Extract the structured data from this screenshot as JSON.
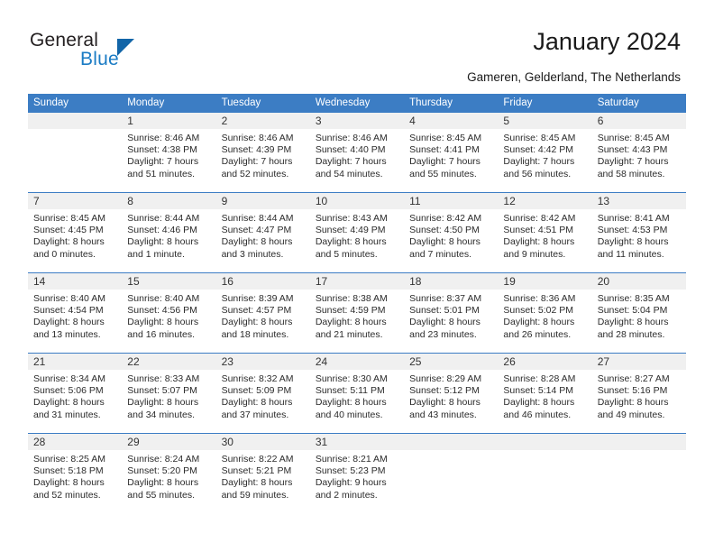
{
  "brand": {
    "name_primary": "General",
    "name_secondary": "Blue",
    "triangle_icon": "logo-triangle-icon",
    "color_primary": "#231f20",
    "color_secondary": "#1a7bc4",
    "color_triangle": "#1265a8"
  },
  "header": {
    "title": "January 2024",
    "subtitle": "Gameren, Gelderland, The Netherlands"
  },
  "theme": {
    "header_band": "#3c7dc4",
    "day_number_band": "#f0f0f0",
    "text": "#2b2b2b"
  },
  "weekdays": [
    "Sunday",
    "Monday",
    "Tuesday",
    "Wednesday",
    "Thursday",
    "Friday",
    "Saturday"
  ],
  "weeks": [
    [
      {
        "day": "",
        "sunrise": "",
        "sunset": "",
        "daylight1": "",
        "daylight2": ""
      },
      {
        "day": "1",
        "sunrise": "Sunrise: 8:46 AM",
        "sunset": "Sunset: 4:38 PM",
        "daylight1": "Daylight: 7 hours",
        "daylight2": "and 51 minutes."
      },
      {
        "day": "2",
        "sunrise": "Sunrise: 8:46 AM",
        "sunset": "Sunset: 4:39 PM",
        "daylight1": "Daylight: 7 hours",
        "daylight2": "and 52 minutes."
      },
      {
        "day": "3",
        "sunrise": "Sunrise: 8:46 AM",
        "sunset": "Sunset: 4:40 PM",
        "daylight1": "Daylight: 7 hours",
        "daylight2": "and 54 minutes."
      },
      {
        "day": "4",
        "sunrise": "Sunrise: 8:45 AM",
        "sunset": "Sunset: 4:41 PM",
        "daylight1": "Daylight: 7 hours",
        "daylight2": "and 55 minutes."
      },
      {
        "day": "5",
        "sunrise": "Sunrise: 8:45 AM",
        "sunset": "Sunset: 4:42 PM",
        "daylight1": "Daylight: 7 hours",
        "daylight2": "and 56 minutes."
      },
      {
        "day": "6",
        "sunrise": "Sunrise: 8:45 AM",
        "sunset": "Sunset: 4:43 PM",
        "daylight1": "Daylight: 7 hours",
        "daylight2": "and 58 minutes."
      }
    ],
    [
      {
        "day": "7",
        "sunrise": "Sunrise: 8:45 AM",
        "sunset": "Sunset: 4:45 PM",
        "daylight1": "Daylight: 8 hours",
        "daylight2": "and 0 minutes."
      },
      {
        "day": "8",
        "sunrise": "Sunrise: 8:44 AM",
        "sunset": "Sunset: 4:46 PM",
        "daylight1": "Daylight: 8 hours",
        "daylight2": "and 1 minute."
      },
      {
        "day": "9",
        "sunrise": "Sunrise: 8:44 AM",
        "sunset": "Sunset: 4:47 PM",
        "daylight1": "Daylight: 8 hours",
        "daylight2": "and 3 minutes."
      },
      {
        "day": "10",
        "sunrise": "Sunrise: 8:43 AM",
        "sunset": "Sunset: 4:49 PM",
        "daylight1": "Daylight: 8 hours",
        "daylight2": "and 5 minutes."
      },
      {
        "day": "11",
        "sunrise": "Sunrise: 8:42 AM",
        "sunset": "Sunset: 4:50 PM",
        "daylight1": "Daylight: 8 hours",
        "daylight2": "and 7 minutes."
      },
      {
        "day": "12",
        "sunrise": "Sunrise: 8:42 AM",
        "sunset": "Sunset: 4:51 PM",
        "daylight1": "Daylight: 8 hours",
        "daylight2": "and 9 minutes."
      },
      {
        "day": "13",
        "sunrise": "Sunrise: 8:41 AM",
        "sunset": "Sunset: 4:53 PM",
        "daylight1": "Daylight: 8 hours",
        "daylight2": "and 11 minutes."
      }
    ],
    [
      {
        "day": "14",
        "sunrise": "Sunrise: 8:40 AM",
        "sunset": "Sunset: 4:54 PM",
        "daylight1": "Daylight: 8 hours",
        "daylight2": "and 13 minutes."
      },
      {
        "day": "15",
        "sunrise": "Sunrise: 8:40 AM",
        "sunset": "Sunset: 4:56 PM",
        "daylight1": "Daylight: 8 hours",
        "daylight2": "and 16 minutes."
      },
      {
        "day": "16",
        "sunrise": "Sunrise: 8:39 AM",
        "sunset": "Sunset: 4:57 PM",
        "daylight1": "Daylight: 8 hours",
        "daylight2": "and 18 minutes."
      },
      {
        "day": "17",
        "sunrise": "Sunrise: 8:38 AM",
        "sunset": "Sunset: 4:59 PM",
        "daylight1": "Daylight: 8 hours",
        "daylight2": "and 21 minutes."
      },
      {
        "day": "18",
        "sunrise": "Sunrise: 8:37 AM",
        "sunset": "Sunset: 5:01 PM",
        "daylight1": "Daylight: 8 hours",
        "daylight2": "and 23 minutes."
      },
      {
        "day": "19",
        "sunrise": "Sunrise: 8:36 AM",
        "sunset": "Sunset: 5:02 PM",
        "daylight1": "Daylight: 8 hours",
        "daylight2": "and 26 minutes."
      },
      {
        "day": "20",
        "sunrise": "Sunrise: 8:35 AM",
        "sunset": "Sunset: 5:04 PM",
        "daylight1": "Daylight: 8 hours",
        "daylight2": "and 28 minutes."
      }
    ],
    [
      {
        "day": "21",
        "sunrise": "Sunrise: 8:34 AM",
        "sunset": "Sunset: 5:06 PM",
        "daylight1": "Daylight: 8 hours",
        "daylight2": "and 31 minutes."
      },
      {
        "day": "22",
        "sunrise": "Sunrise: 8:33 AM",
        "sunset": "Sunset: 5:07 PM",
        "daylight1": "Daylight: 8 hours",
        "daylight2": "and 34 minutes."
      },
      {
        "day": "23",
        "sunrise": "Sunrise: 8:32 AM",
        "sunset": "Sunset: 5:09 PM",
        "daylight1": "Daylight: 8 hours",
        "daylight2": "and 37 minutes."
      },
      {
        "day": "24",
        "sunrise": "Sunrise: 8:30 AM",
        "sunset": "Sunset: 5:11 PM",
        "daylight1": "Daylight: 8 hours",
        "daylight2": "and 40 minutes."
      },
      {
        "day": "25",
        "sunrise": "Sunrise: 8:29 AM",
        "sunset": "Sunset: 5:12 PM",
        "daylight1": "Daylight: 8 hours",
        "daylight2": "and 43 minutes."
      },
      {
        "day": "26",
        "sunrise": "Sunrise: 8:28 AM",
        "sunset": "Sunset: 5:14 PM",
        "daylight1": "Daylight: 8 hours",
        "daylight2": "and 46 minutes."
      },
      {
        "day": "27",
        "sunrise": "Sunrise: 8:27 AM",
        "sunset": "Sunset: 5:16 PM",
        "daylight1": "Daylight: 8 hours",
        "daylight2": "and 49 minutes."
      }
    ],
    [
      {
        "day": "28",
        "sunrise": "Sunrise: 8:25 AM",
        "sunset": "Sunset: 5:18 PM",
        "daylight1": "Daylight: 8 hours",
        "daylight2": "and 52 minutes."
      },
      {
        "day": "29",
        "sunrise": "Sunrise: 8:24 AM",
        "sunset": "Sunset: 5:20 PM",
        "daylight1": "Daylight: 8 hours",
        "daylight2": "and 55 minutes."
      },
      {
        "day": "30",
        "sunrise": "Sunrise: 8:22 AM",
        "sunset": "Sunset: 5:21 PM",
        "daylight1": "Daylight: 8 hours",
        "daylight2": "and 59 minutes."
      },
      {
        "day": "31",
        "sunrise": "Sunrise: 8:21 AM",
        "sunset": "Sunset: 5:23 PM",
        "daylight1": "Daylight: 9 hours",
        "daylight2": "and 2 minutes."
      },
      {
        "day": "",
        "sunrise": "",
        "sunset": "",
        "daylight1": "",
        "daylight2": ""
      },
      {
        "day": "",
        "sunrise": "",
        "sunset": "",
        "daylight1": "",
        "daylight2": ""
      },
      {
        "day": "",
        "sunrise": "",
        "sunset": "",
        "daylight1": "",
        "daylight2": ""
      }
    ]
  ]
}
